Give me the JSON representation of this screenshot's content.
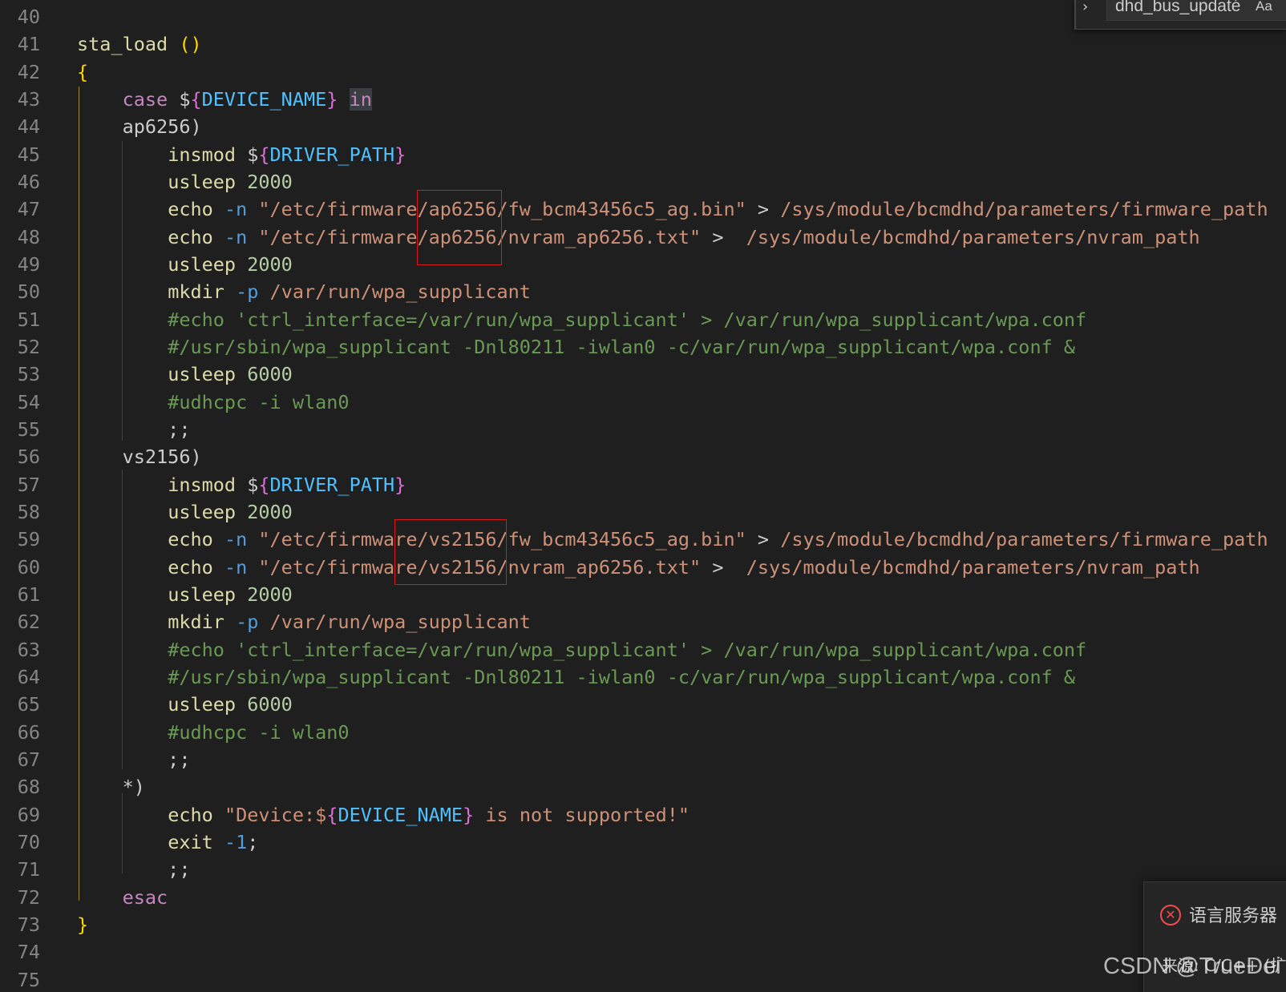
{
  "find_widget": {
    "query": "dhd_bus_updaté",
    "match_case_label": "Aa"
  },
  "editor": {
    "lines": [
      {
        "num": "40",
        "tokens": []
      },
      {
        "num": "41",
        "tokens": [
          {
            "t": "sta_load ",
            "c": "fn"
          },
          {
            "t": "()",
            "c": "paren"
          }
        ]
      },
      {
        "num": "42",
        "tokens": [
          {
            "t": "{",
            "c": "paren"
          }
        ]
      },
      {
        "num": "43",
        "tokens": [
          {
            "t": "    "
          },
          {
            "t": "case",
            "c": "kw"
          },
          {
            "t": " $"
          },
          {
            "t": "{",
            "c": "brace"
          },
          {
            "t": "DEVICE_NAME",
            "c": "var"
          },
          {
            "t": "}",
            "c": "brace"
          },
          {
            "t": " "
          },
          {
            "t": "in",
            "c": "in-hl"
          }
        ]
      },
      {
        "num": "44",
        "tokens": [
          {
            "t": "    ap6256)"
          }
        ]
      },
      {
        "num": "45",
        "tokens": [
          {
            "t": "        "
          },
          {
            "t": "insmod",
            "c": "fn"
          },
          {
            "t": " $"
          },
          {
            "t": "{",
            "c": "brace"
          },
          {
            "t": "DRIVER_PATH",
            "c": "var"
          },
          {
            "t": "}",
            "c": "brace"
          }
        ]
      },
      {
        "num": "46",
        "tokens": [
          {
            "t": "        "
          },
          {
            "t": "usleep",
            "c": "fn"
          },
          {
            "t": " "
          },
          {
            "t": "2000",
            "c": "num"
          }
        ]
      },
      {
        "num": "47",
        "tokens": [
          {
            "t": "        "
          },
          {
            "t": "echo",
            "c": "fn"
          },
          {
            "t": " "
          },
          {
            "t": "-n",
            "c": "op"
          },
          {
            "t": " "
          },
          {
            "t": "\"/etc/firmware/ap6256/fw_bcm43456c5_ag.bin\"",
            "c": "str"
          },
          {
            "t": " > "
          },
          {
            "t": "/sys/module/bcmdhd/parameters/firmware_path",
            "c": "str"
          }
        ]
      },
      {
        "num": "48",
        "tokens": [
          {
            "t": "        "
          },
          {
            "t": "echo",
            "c": "fn"
          },
          {
            "t": " "
          },
          {
            "t": "-n",
            "c": "op"
          },
          {
            "t": " "
          },
          {
            "t": "\"/etc/firmware/ap6256/nvram_ap6256.txt\"",
            "c": "str"
          },
          {
            "t": " >  "
          },
          {
            "t": "/sys/module/bcmdhd/parameters/nvram_path",
            "c": "str"
          }
        ]
      },
      {
        "num": "49",
        "tokens": [
          {
            "t": "        "
          },
          {
            "t": "usleep",
            "c": "fn"
          },
          {
            "t": " "
          },
          {
            "t": "2000",
            "c": "num"
          }
        ]
      },
      {
        "num": "50",
        "tokens": [
          {
            "t": "        "
          },
          {
            "t": "mkdir",
            "c": "fn"
          },
          {
            "t": " "
          },
          {
            "t": "-p",
            "c": "op"
          },
          {
            "t": " "
          },
          {
            "t": "/var/run/wpa_supplicant",
            "c": "str"
          }
        ]
      },
      {
        "num": "51",
        "tokens": [
          {
            "t": "        "
          },
          {
            "t": "#echo 'ctrl_interface=/var/run/wpa_supplicant' > /var/run/wpa_supplicant/wpa.conf",
            "c": "cmt"
          }
        ]
      },
      {
        "num": "52",
        "tokens": [
          {
            "t": "        "
          },
          {
            "t": "#/usr/sbin/wpa_supplicant -Dnl80211 -iwlan0 -c/var/run/wpa_supplicant/wpa.conf &",
            "c": "cmt"
          }
        ]
      },
      {
        "num": "53",
        "tokens": [
          {
            "t": "        "
          },
          {
            "t": "usleep",
            "c": "fn"
          },
          {
            "t": " "
          },
          {
            "t": "6000",
            "c": "num"
          }
        ]
      },
      {
        "num": "54",
        "tokens": [
          {
            "t": "        "
          },
          {
            "t": "#udhcpc -i wlan0",
            "c": "cmt"
          }
        ]
      },
      {
        "num": "55",
        "tokens": [
          {
            "t": "        ;;"
          }
        ]
      },
      {
        "num": "56",
        "tokens": [
          {
            "t": "    vs2156)"
          }
        ]
      },
      {
        "num": "57",
        "tokens": [
          {
            "t": "        "
          },
          {
            "t": "insmod",
            "c": "fn"
          },
          {
            "t": " $"
          },
          {
            "t": "{",
            "c": "brace"
          },
          {
            "t": "DRIVER_PATH",
            "c": "var"
          },
          {
            "t": "}",
            "c": "brace"
          }
        ]
      },
      {
        "num": "58",
        "tokens": [
          {
            "t": "        "
          },
          {
            "t": "usleep",
            "c": "fn"
          },
          {
            "t": " "
          },
          {
            "t": "2000",
            "c": "num"
          }
        ]
      },
      {
        "num": "59",
        "tokens": [
          {
            "t": "        "
          },
          {
            "t": "echo",
            "c": "fn"
          },
          {
            "t": " "
          },
          {
            "t": "-n",
            "c": "op"
          },
          {
            "t": " "
          },
          {
            "t": "\"/etc/firmware/vs2156/fw_bcm43456c5_ag.bin\"",
            "c": "str"
          },
          {
            "t": " > "
          },
          {
            "t": "/sys/module/bcmdhd/parameters/firmware_path",
            "c": "str"
          }
        ]
      },
      {
        "num": "60",
        "tokens": [
          {
            "t": "        "
          },
          {
            "t": "echo",
            "c": "fn"
          },
          {
            "t": " "
          },
          {
            "t": "-n",
            "c": "op"
          },
          {
            "t": " "
          },
          {
            "t": "\"/etc/firmware/vs2156/nvram_ap6256.txt\"",
            "c": "str"
          },
          {
            "t": " >  "
          },
          {
            "t": "/sys/module/bcmdhd/parameters/nvram_path",
            "c": "str"
          }
        ]
      },
      {
        "num": "61",
        "tokens": [
          {
            "t": "        "
          },
          {
            "t": "usleep",
            "c": "fn"
          },
          {
            "t": " "
          },
          {
            "t": "2000",
            "c": "num"
          }
        ]
      },
      {
        "num": "62",
        "tokens": [
          {
            "t": "        "
          },
          {
            "t": "mkdir",
            "c": "fn"
          },
          {
            "t": " "
          },
          {
            "t": "-p",
            "c": "op"
          },
          {
            "t": " "
          },
          {
            "t": "/var/run/wpa_supplicant",
            "c": "str"
          }
        ]
      },
      {
        "num": "63",
        "tokens": [
          {
            "t": "        "
          },
          {
            "t": "#echo 'ctrl_interface=/var/run/wpa_supplicant' > /var/run/wpa_supplicant/wpa.conf",
            "c": "cmt"
          }
        ]
      },
      {
        "num": "64",
        "tokens": [
          {
            "t": "        "
          },
          {
            "t": "#/usr/sbin/wpa_supplicant -Dnl80211 -iwlan0 -c/var/run/wpa_supplicant/wpa.conf &",
            "c": "cmt"
          }
        ]
      },
      {
        "num": "65",
        "tokens": [
          {
            "t": "        "
          },
          {
            "t": "usleep",
            "c": "fn"
          },
          {
            "t": " "
          },
          {
            "t": "6000",
            "c": "num"
          }
        ]
      },
      {
        "num": "66",
        "tokens": [
          {
            "t": "        "
          },
          {
            "t": "#udhcpc -i wlan0",
            "c": "cmt"
          }
        ]
      },
      {
        "num": "67",
        "tokens": [
          {
            "t": "        ;;"
          }
        ]
      },
      {
        "num": "68",
        "tokens": [
          {
            "t": "    *)"
          }
        ]
      },
      {
        "num": "69",
        "tokens": [
          {
            "t": "        "
          },
          {
            "t": "echo",
            "c": "fn"
          },
          {
            "t": " "
          },
          {
            "t": "\"Device:$",
            "c": "str"
          },
          {
            "t": "{",
            "c": "brace"
          },
          {
            "t": "DEVICE_NAME",
            "c": "var"
          },
          {
            "t": "}",
            "c": "brace"
          },
          {
            "t": " is not supported!\"",
            "c": "str"
          }
        ]
      },
      {
        "num": "70",
        "tokens": [
          {
            "t": "        "
          },
          {
            "t": "exit",
            "c": "fn"
          },
          {
            "t": " "
          },
          {
            "t": "-1",
            "c": "op"
          },
          {
            "t": ";"
          }
        ]
      },
      {
        "num": "71",
        "tokens": [
          {
            "t": "        ;;"
          }
        ]
      },
      {
        "num": "72",
        "tokens": [
          {
            "t": "    "
          },
          {
            "t": "esac",
            "c": "kw"
          }
        ]
      },
      {
        "num": "73",
        "tokens": [
          {
            "t": "}",
            "c": "paren"
          }
        ]
      },
      {
        "num": "74",
        "tokens": []
      },
      {
        "num": "75",
        "tokens": []
      }
    ]
  },
  "notification": {
    "title": "语言服务器",
    "source": "来源: C/C++ (扩"
  },
  "watermark": {
    "text": "CSDN @TrueDei"
  }
}
